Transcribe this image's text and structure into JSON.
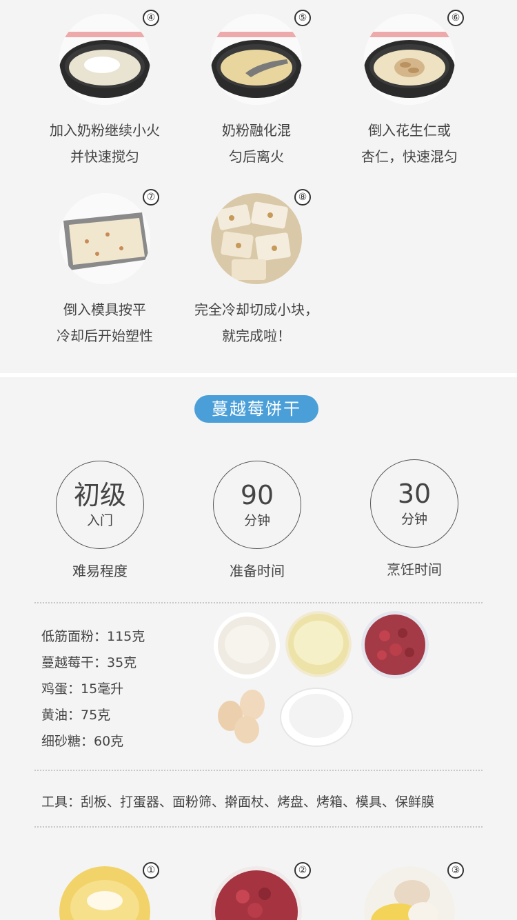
{
  "top_steps": [
    {
      "num": "④",
      "line1": "加入奶粉继续小火",
      "line2": "并快速搅匀"
    },
    {
      "num": "⑤",
      "line1": "奶粉融化混",
      "line2": "匀后离火"
    },
    {
      "num": "⑥",
      "line1": "倒入花生仁或",
      "line2": "杏仁，快速混匀"
    },
    {
      "num": "⑦",
      "line1": "倒入模具按平",
      "line2": "冷却后开始塑性"
    },
    {
      "num": "⑧",
      "line1": "完全冷却切成小块，",
      "line2": "就完成啦！"
    }
  ],
  "recipe_title": "蔓越莓饼干",
  "stats": [
    {
      "big": "初级",
      "small": "入门",
      "label": "难易程度"
    },
    {
      "big": "90",
      "small": "分钟",
      "label": "准备时间"
    },
    {
      "big": "30",
      "small": "分钟",
      "label": "烹饪时间"
    }
  ],
  "ingredients": [
    "低筋面粉：115克",
    "蔓越莓干：35克",
    "鸡蛋：15毫升",
    "黄油：75克",
    "细砂糖：60克"
  ],
  "tools": "工具：刮板、打蛋器、面粉筛、擀面杖、烤盘、烤箱、模具、保鲜膜",
  "bottom_steps": [
    {
      "num": "①"
    },
    {
      "num": "②"
    },
    {
      "num": "③"
    }
  ],
  "colors": {
    "title_pill": "#4a9fd8",
    "background": "#f4f4f4"
  }
}
